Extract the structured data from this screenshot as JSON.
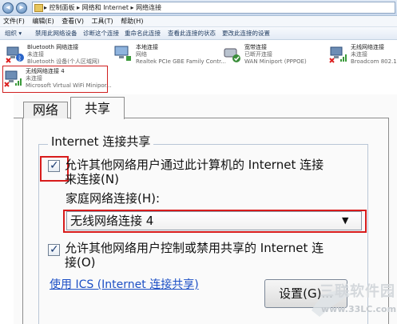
{
  "explorer": {
    "address_path": "▸ 控制面板 ▸ 网络和 Internet ▸ 网络连接",
    "menu": [
      "文件(F)",
      "编辑(E)",
      "查看(V)",
      "工具(T)",
      "帮助(H)"
    ],
    "toolbar": [
      "组织 ▾",
      "禁用此网络设备",
      "诊断这个连接",
      "重命名此连接",
      "查看此连接的状态",
      "更改此连接的设置"
    ],
    "connections": [
      {
        "name": "Bluetooth 网络连接",
        "status": "未连接",
        "device": "Bluetooth 设备(个人区域网)"
      },
      {
        "name": "本地连接",
        "status": "网络",
        "device": "Realtek PCIe GBE Family Contr..."
      },
      {
        "name": "宽带连接",
        "status": "已断开连接",
        "device": "WAN Miniport (PPPOE)"
      },
      {
        "name": "无线网络连接",
        "status": "未连接",
        "device": "Broadcom 802.11n"
      },
      {
        "name": "无线网络连接 4",
        "status": "未连接",
        "device": "Microsoft Virtual WiFi Minipor..."
      }
    ]
  },
  "dialog": {
    "tabs": [
      "网络",
      "共享"
    ],
    "group_title": "Internet 连接共享",
    "allow_share_line1": "允许其他网络用户通过此计算机的 Internet 连接",
    "allow_share_line2": "来连接(N)",
    "home_network_label": "家庭网络连接(H):",
    "home_network_value": "无线网络连接 4",
    "allow_control_line1": "允许其他网络用户控制或禁用共享的 Internet 连",
    "allow_control_line2": "接(O)",
    "ics_link": "使用 ICS (Internet 连接共享)",
    "settings_button": "设置(G)..."
  },
  "watermark": {
    "text": "三联软件园",
    "url": "www.33LC.com"
  },
  "colors": {
    "highlight_red": "#d81c1c",
    "link_blue": "#1c4fc5"
  }
}
